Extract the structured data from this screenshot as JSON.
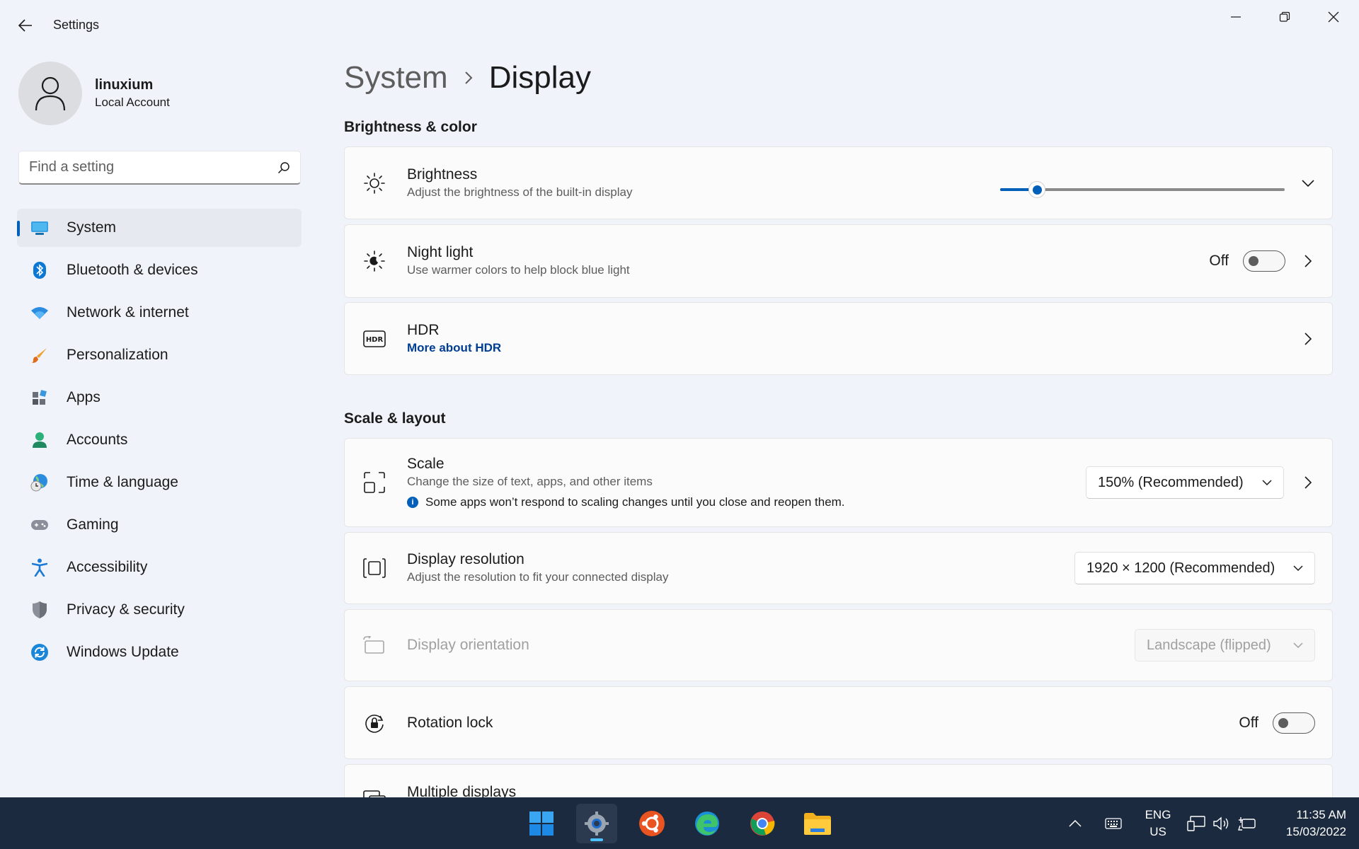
{
  "window": {
    "title": "Settings",
    "controls": [
      "minimize-icon",
      "restore-icon",
      "close-icon"
    ]
  },
  "profile": {
    "name": "linuxium",
    "account_type": "Local Account"
  },
  "search": {
    "placeholder": "Find a setting"
  },
  "sidebar": {
    "items": [
      {
        "label": "System",
        "icon": "system-icon",
        "active": true
      },
      {
        "label": "Bluetooth & devices",
        "icon": "bluetooth-icon"
      },
      {
        "label": "Network & internet",
        "icon": "wifi-icon"
      },
      {
        "label": "Personalization",
        "icon": "brush-icon"
      },
      {
        "label": "Apps",
        "icon": "apps-icon"
      },
      {
        "label": "Accounts",
        "icon": "person-icon"
      },
      {
        "label": "Time & language",
        "icon": "globe-clock-icon"
      },
      {
        "label": "Gaming",
        "icon": "gamepad-icon"
      },
      {
        "label": "Accessibility",
        "icon": "accessibility-icon"
      },
      {
        "label": "Privacy & security",
        "icon": "shield-icon"
      },
      {
        "label": "Windows Update",
        "icon": "update-icon"
      }
    ]
  },
  "breadcrumb": {
    "parent": "System",
    "current": "Display"
  },
  "sections": {
    "brightness_color": "Brightness & color",
    "scale_layout": "Scale & layout"
  },
  "brightness": {
    "title": "Brightness",
    "subtitle": "Adjust the brightness of the built-in display",
    "level_fraction": 0.13
  },
  "night_light": {
    "title": "Night light",
    "subtitle": "Use warmer colors to help block blue light",
    "state": "Off"
  },
  "hdr": {
    "title": "HDR",
    "link": "More about HDR"
  },
  "scale": {
    "title": "Scale",
    "subtitle": "Change the size of text, apps, and other items",
    "note": "Some apps won’t respond to scaling changes until you close and reopen them.",
    "value": "150% (Recommended)"
  },
  "resolution": {
    "title": "Display resolution",
    "subtitle": "Adjust the resolution to fit your connected display",
    "value": "1920 × 1200 (Recommended)"
  },
  "orientation": {
    "title": "Display orientation",
    "value": "Landscape (flipped)"
  },
  "rotation_lock": {
    "title": "Rotation lock",
    "state": "Off"
  },
  "multiple_displays": {
    "title": "Multiple displays"
  },
  "taskbar": {
    "apps": [
      "start-icon",
      "settings-icon",
      "ubuntu-icon",
      "edge-icon",
      "chrome-icon",
      "file-explorer-icon"
    ],
    "language_line1": "ENG",
    "language_line2": "US",
    "time": "11:35 AM",
    "date": "15/03/2022"
  },
  "colors": {
    "accent": "#005fb8",
    "taskbar": "#1c2a3f",
    "background": "#f0f3f9"
  }
}
